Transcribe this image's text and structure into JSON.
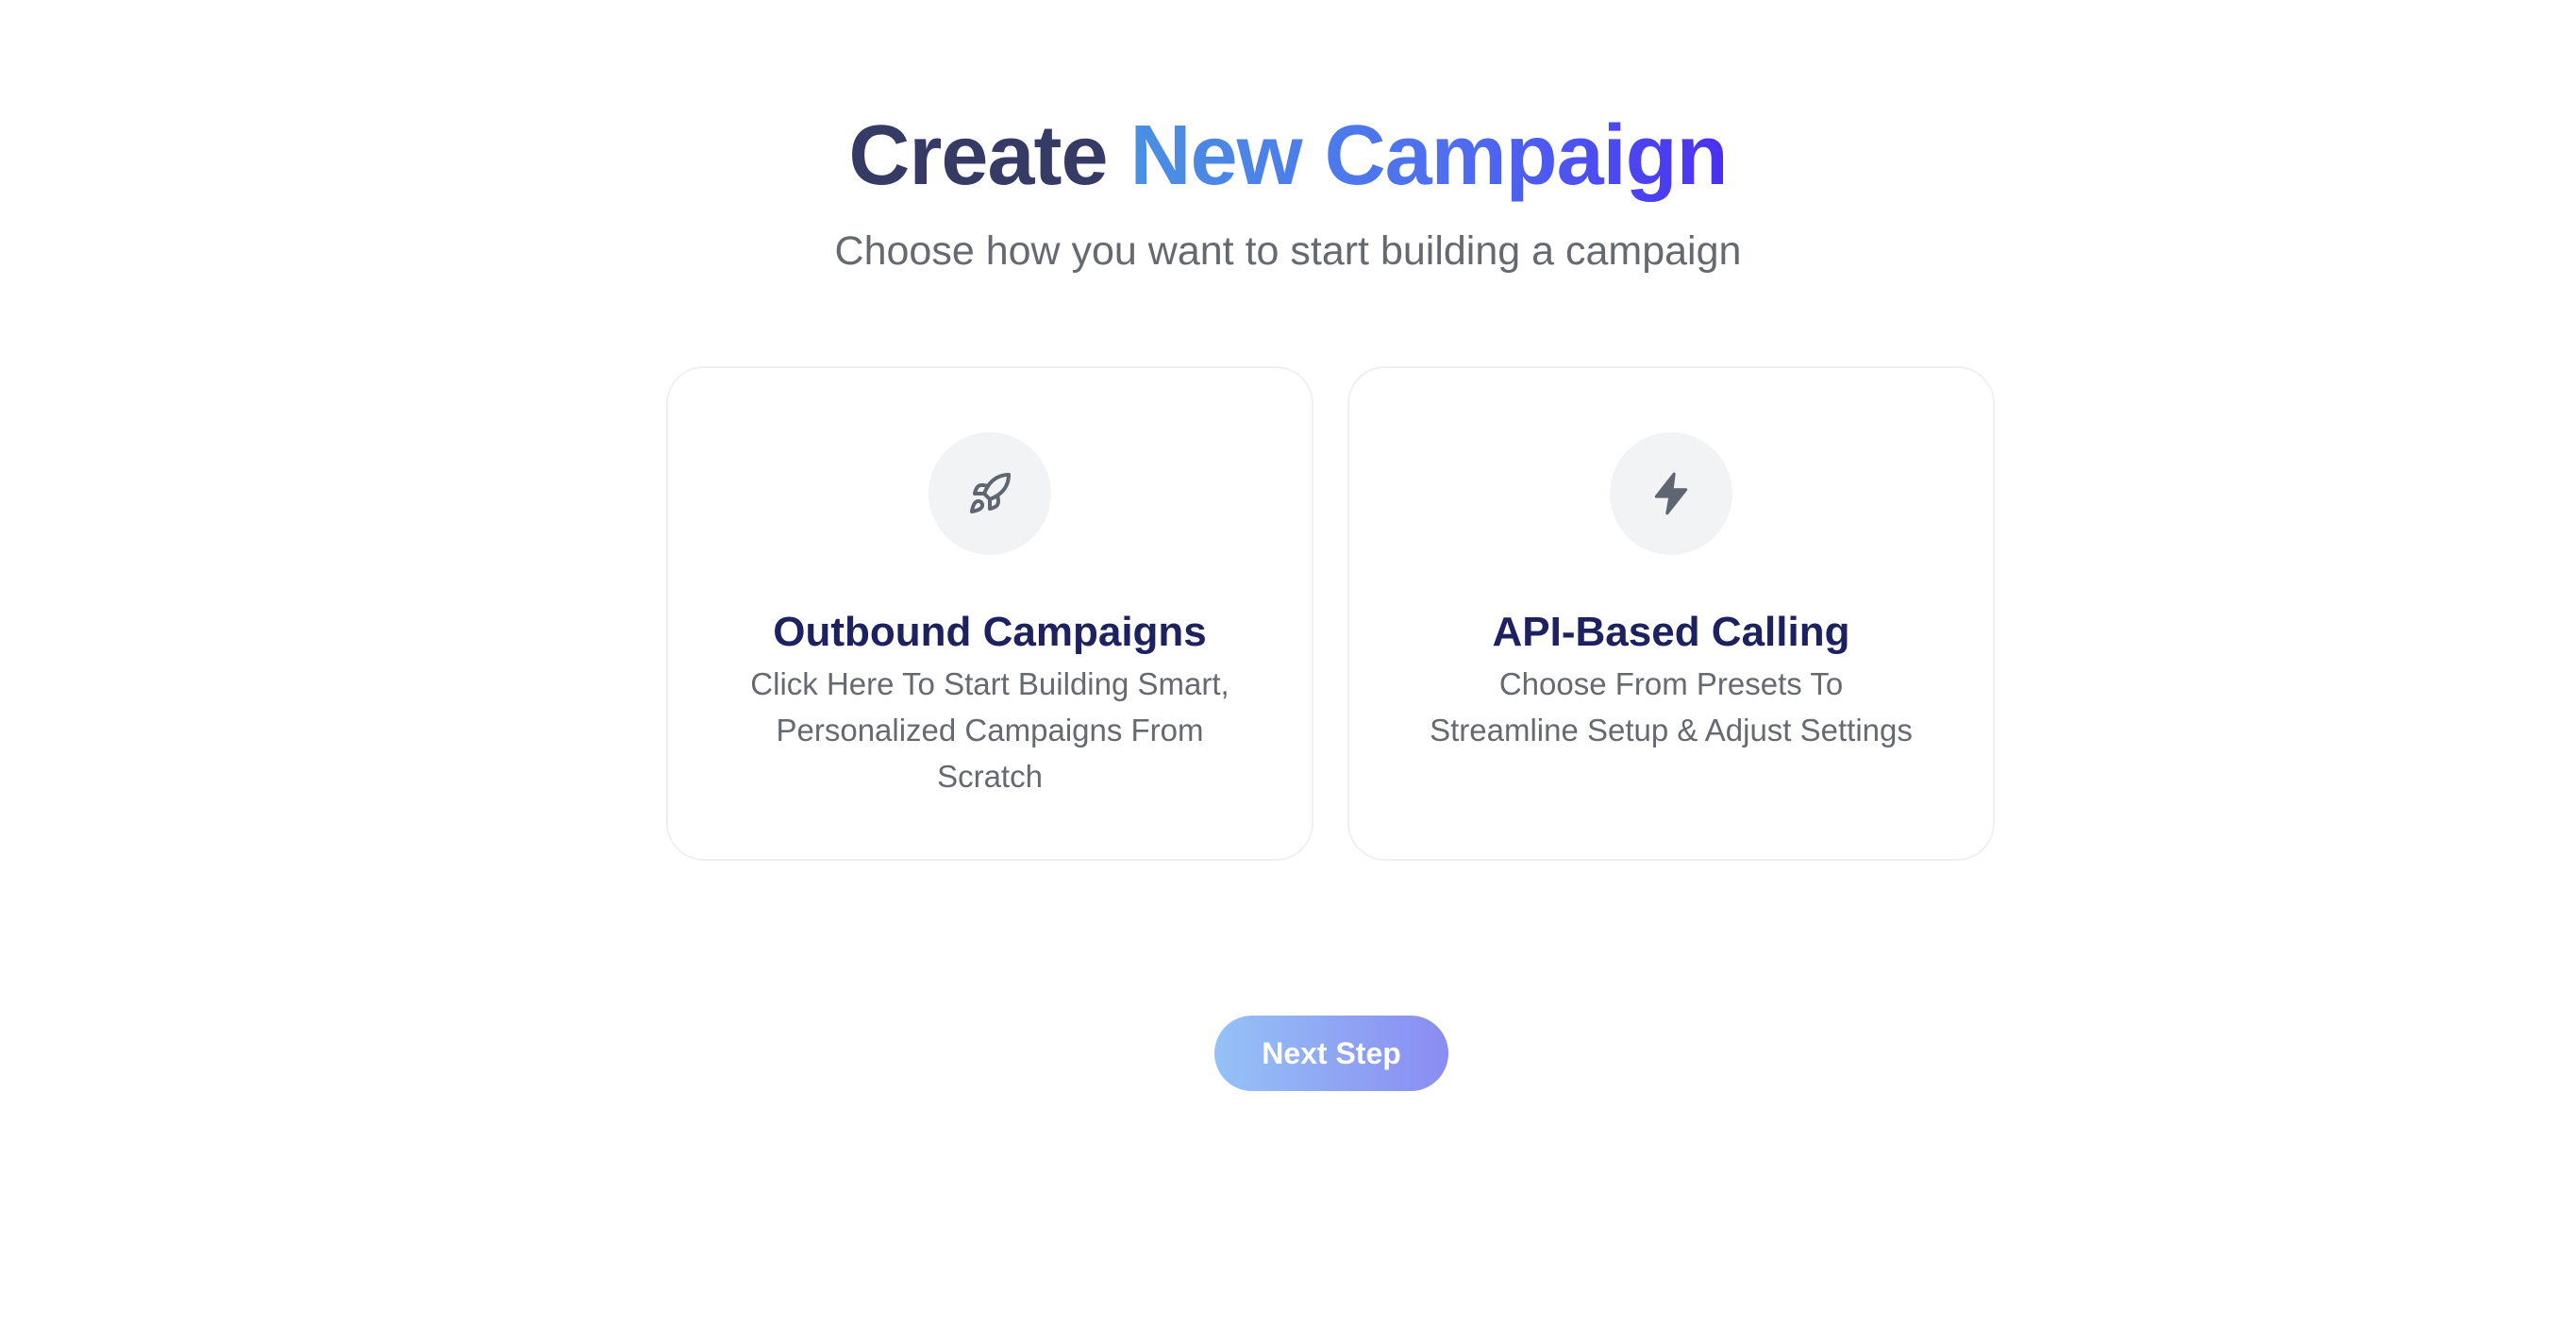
{
  "header": {
    "title_part1": "Create",
    "title_part2": "New Campaign",
    "subtitle": "Choose how you want to start building a campaign"
  },
  "options": [
    {
      "icon": "rocket-icon",
      "title": "Outbound Campaigns",
      "description": "Click Here To Start Building Smart, Personalized Campaigns From Scratch"
    },
    {
      "icon": "lightning-icon",
      "title": "API-Based Calling",
      "description": "Choose From Presets To Streamline Setup & Adjust Settings"
    }
  ],
  "actions": {
    "next_label": "Next Step"
  },
  "colors": {
    "title_dark": "#353b64",
    "title_gradient_start": "#4a90e2",
    "title_gradient_end": "#4a2ff0",
    "card_title": "#1d2160",
    "button_gradient_start": "#95c2f6",
    "button_gradient_end": "#8a8cf2"
  }
}
